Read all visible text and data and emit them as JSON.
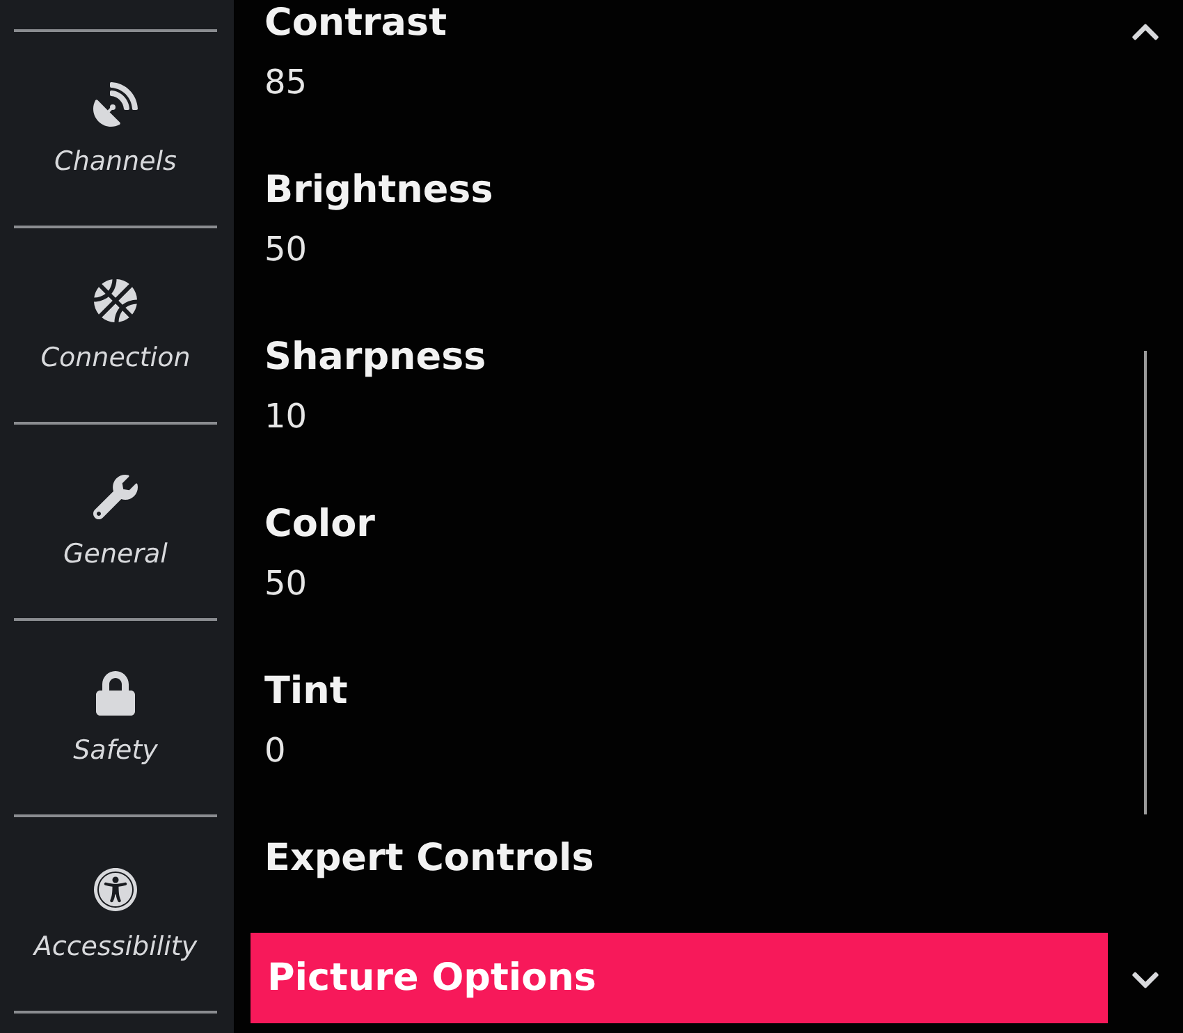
{
  "sidebar": {
    "items": [
      {
        "label": "Channels"
      },
      {
        "label": "Connection"
      },
      {
        "label": "General"
      },
      {
        "label": "Safety"
      },
      {
        "label": "Accessibility"
      }
    ]
  },
  "menu": {
    "items": [
      {
        "label": "Contrast",
        "value": "85",
        "selected": false
      },
      {
        "label": "Brightness",
        "value": "50",
        "selected": false
      },
      {
        "label": "Sharpness",
        "value": "10",
        "selected": false
      },
      {
        "label": "Color",
        "value": "50",
        "selected": false
      },
      {
        "label": "Tint",
        "value": "0",
        "selected": false
      },
      {
        "label": "Expert Controls",
        "selected": false
      },
      {
        "label": "Picture Options",
        "selected": true
      }
    ]
  }
}
